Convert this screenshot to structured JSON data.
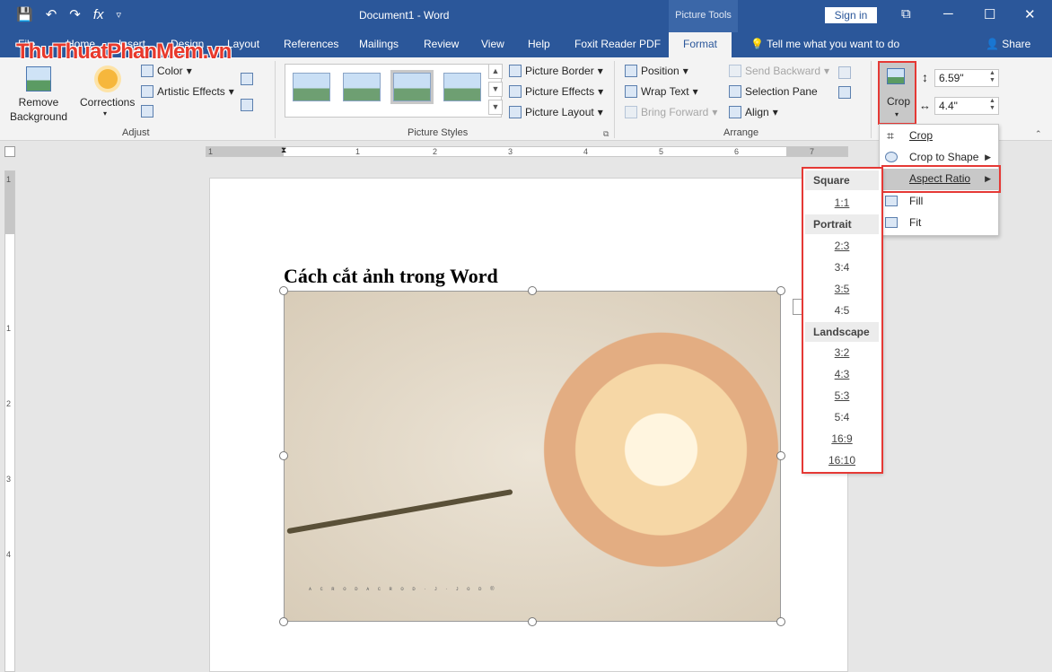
{
  "window": {
    "title": "Document1  -  Word",
    "context_label": "Picture Tools",
    "signin": "Sign in",
    "qat": {
      "save": "💾",
      "undo": "↶",
      "redo": "↷",
      "fx": "fx",
      "customize": "▿"
    },
    "controls": {
      "ribbon_display": "⧉",
      "minimize": "─",
      "maximize": "☐",
      "close": "✕"
    }
  },
  "tabs": [
    "File",
    "Home",
    "Insert",
    "Design",
    "Layout",
    "References",
    "Mailings",
    "Review",
    "View",
    "Help",
    "Foxit Reader PDF",
    "Format"
  ],
  "active_tab": "Format",
  "tell_me": "Tell me what you want to do",
  "share": "Share",
  "watermark": "ThuThuatPhanMem.vn",
  "ribbon": {
    "adjust": {
      "label": "Adjust",
      "remove_bg_1": "Remove",
      "remove_bg_2": "Background",
      "corrections": "Corrections",
      "color": "Color",
      "artistic": "Artistic Effects"
    },
    "styles": {
      "label": "Picture Styles",
      "border": "Picture Border",
      "effects": "Picture Effects",
      "layout": "Picture Layout"
    },
    "arrange": {
      "label": "Arrange",
      "position": "Position",
      "wrap": "Wrap Text",
      "bring_forward": "Bring Forward",
      "send_backward": "Send Backward",
      "selection_pane": "Selection Pane",
      "align": "Align"
    },
    "size": {
      "crop": "Crop",
      "height": "6.59\"",
      "width": "4.4\""
    }
  },
  "ruler": {
    "numbers": [
      "1",
      "1",
      "2",
      "3",
      "4",
      "5",
      "6",
      "7"
    ],
    "vertical_numbers": [
      "1",
      "1",
      "2",
      "3",
      "4"
    ]
  },
  "document": {
    "heading": "Cách cắt ảnh trong Word",
    "photo_caption": "ᴀ ᴄ ʀ ᴏ ᴅ ᴀ ᴄ ʀ ᴏ ᴅ · ᴊ · ᴊ ᴏ ᴅ ®"
  },
  "crop_menu": {
    "items": [
      "Crop",
      "Crop to Shape",
      "Aspect Ratio",
      "Fill",
      "Fit"
    ]
  },
  "aspect_submenu": {
    "square_header": "Square",
    "square": [
      "1:1"
    ],
    "portrait_header": "Portrait",
    "portrait": [
      "2:3",
      "3:4",
      "3:5",
      "4:5"
    ],
    "landscape_header": "Landscape",
    "landscape": [
      "3:2",
      "4:3",
      "5:3",
      "5:4",
      "16:9",
      "16:10"
    ]
  },
  "colors": {
    "title_bar": "#2b579a",
    "highlight_border": "#e53935",
    "watermark": "#e8392c"
  }
}
